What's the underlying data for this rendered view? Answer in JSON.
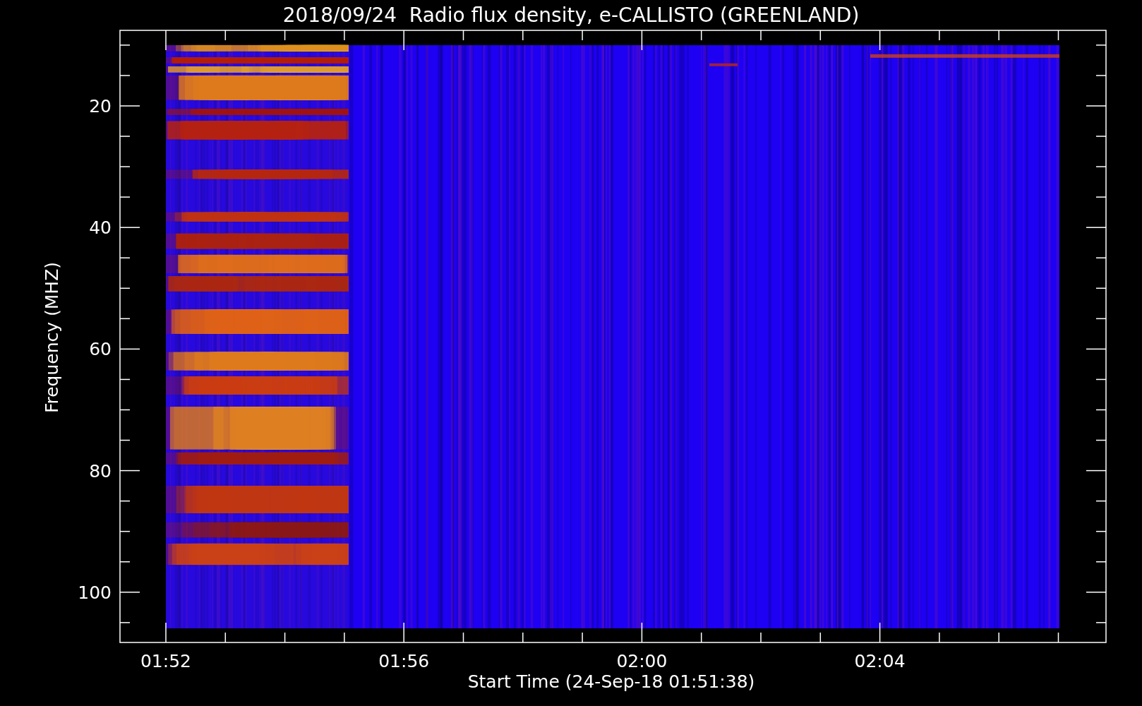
{
  "title": "2018/09/24  Radio flux density, e-CALLISTO (GREENLAND)",
  "y_axis": {
    "label": "Frequency (MHZ)",
    "ticks": [
      "20",
      "40",
      "60",
      "80",
      "100"
    ]
  },
  "x_axis": {
    "label": "Start Time (24-Sep-18 01:51:38)",
    "ticks": [
      "01:52",
      "01:56",
      "02:00",
      "02:04"
    ]
  }
}
